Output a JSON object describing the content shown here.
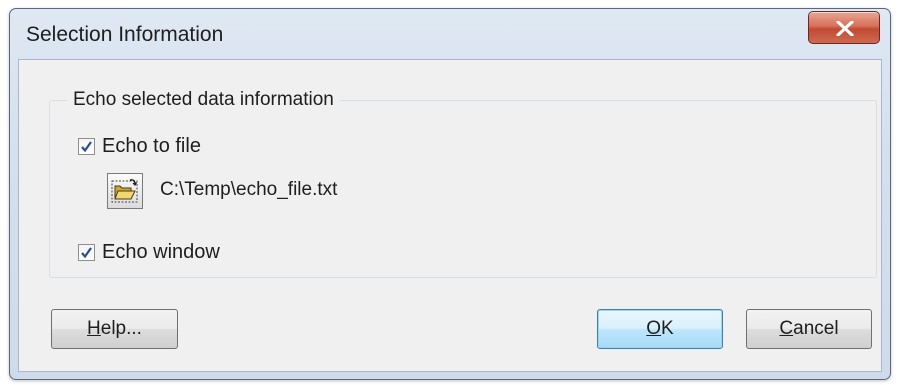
{
  "window": {
    "title": "Selection Information"
  },
  "group": {
    "legend": "Echo selected data information"
  },
  "echo_to_file": {
    "label": "Echo to file",
    "checked": true
  },
  "file": {
    "path": "C:\\Temp\\echo_file.txt",
    "browse_icon": "open-folder-icon"
  },
  "echo_window": {
    "label": "Echo window",
    "checked": true
  },
  "buttons": {
    "help": {
      "accel": "H",
      "rest": "elp..."
    },
    "ok": {
      "accel": "O",
      "rest": "K"
    },
    "cancel": {
      "accel": "C",
      "rest": "ancel"
    }
  },
  "colors": {
    "close_button": "#c24a33",
    "default_button_border": "#3c7fb1",
    "check_mark": "#2a4d8f"
  }
}
